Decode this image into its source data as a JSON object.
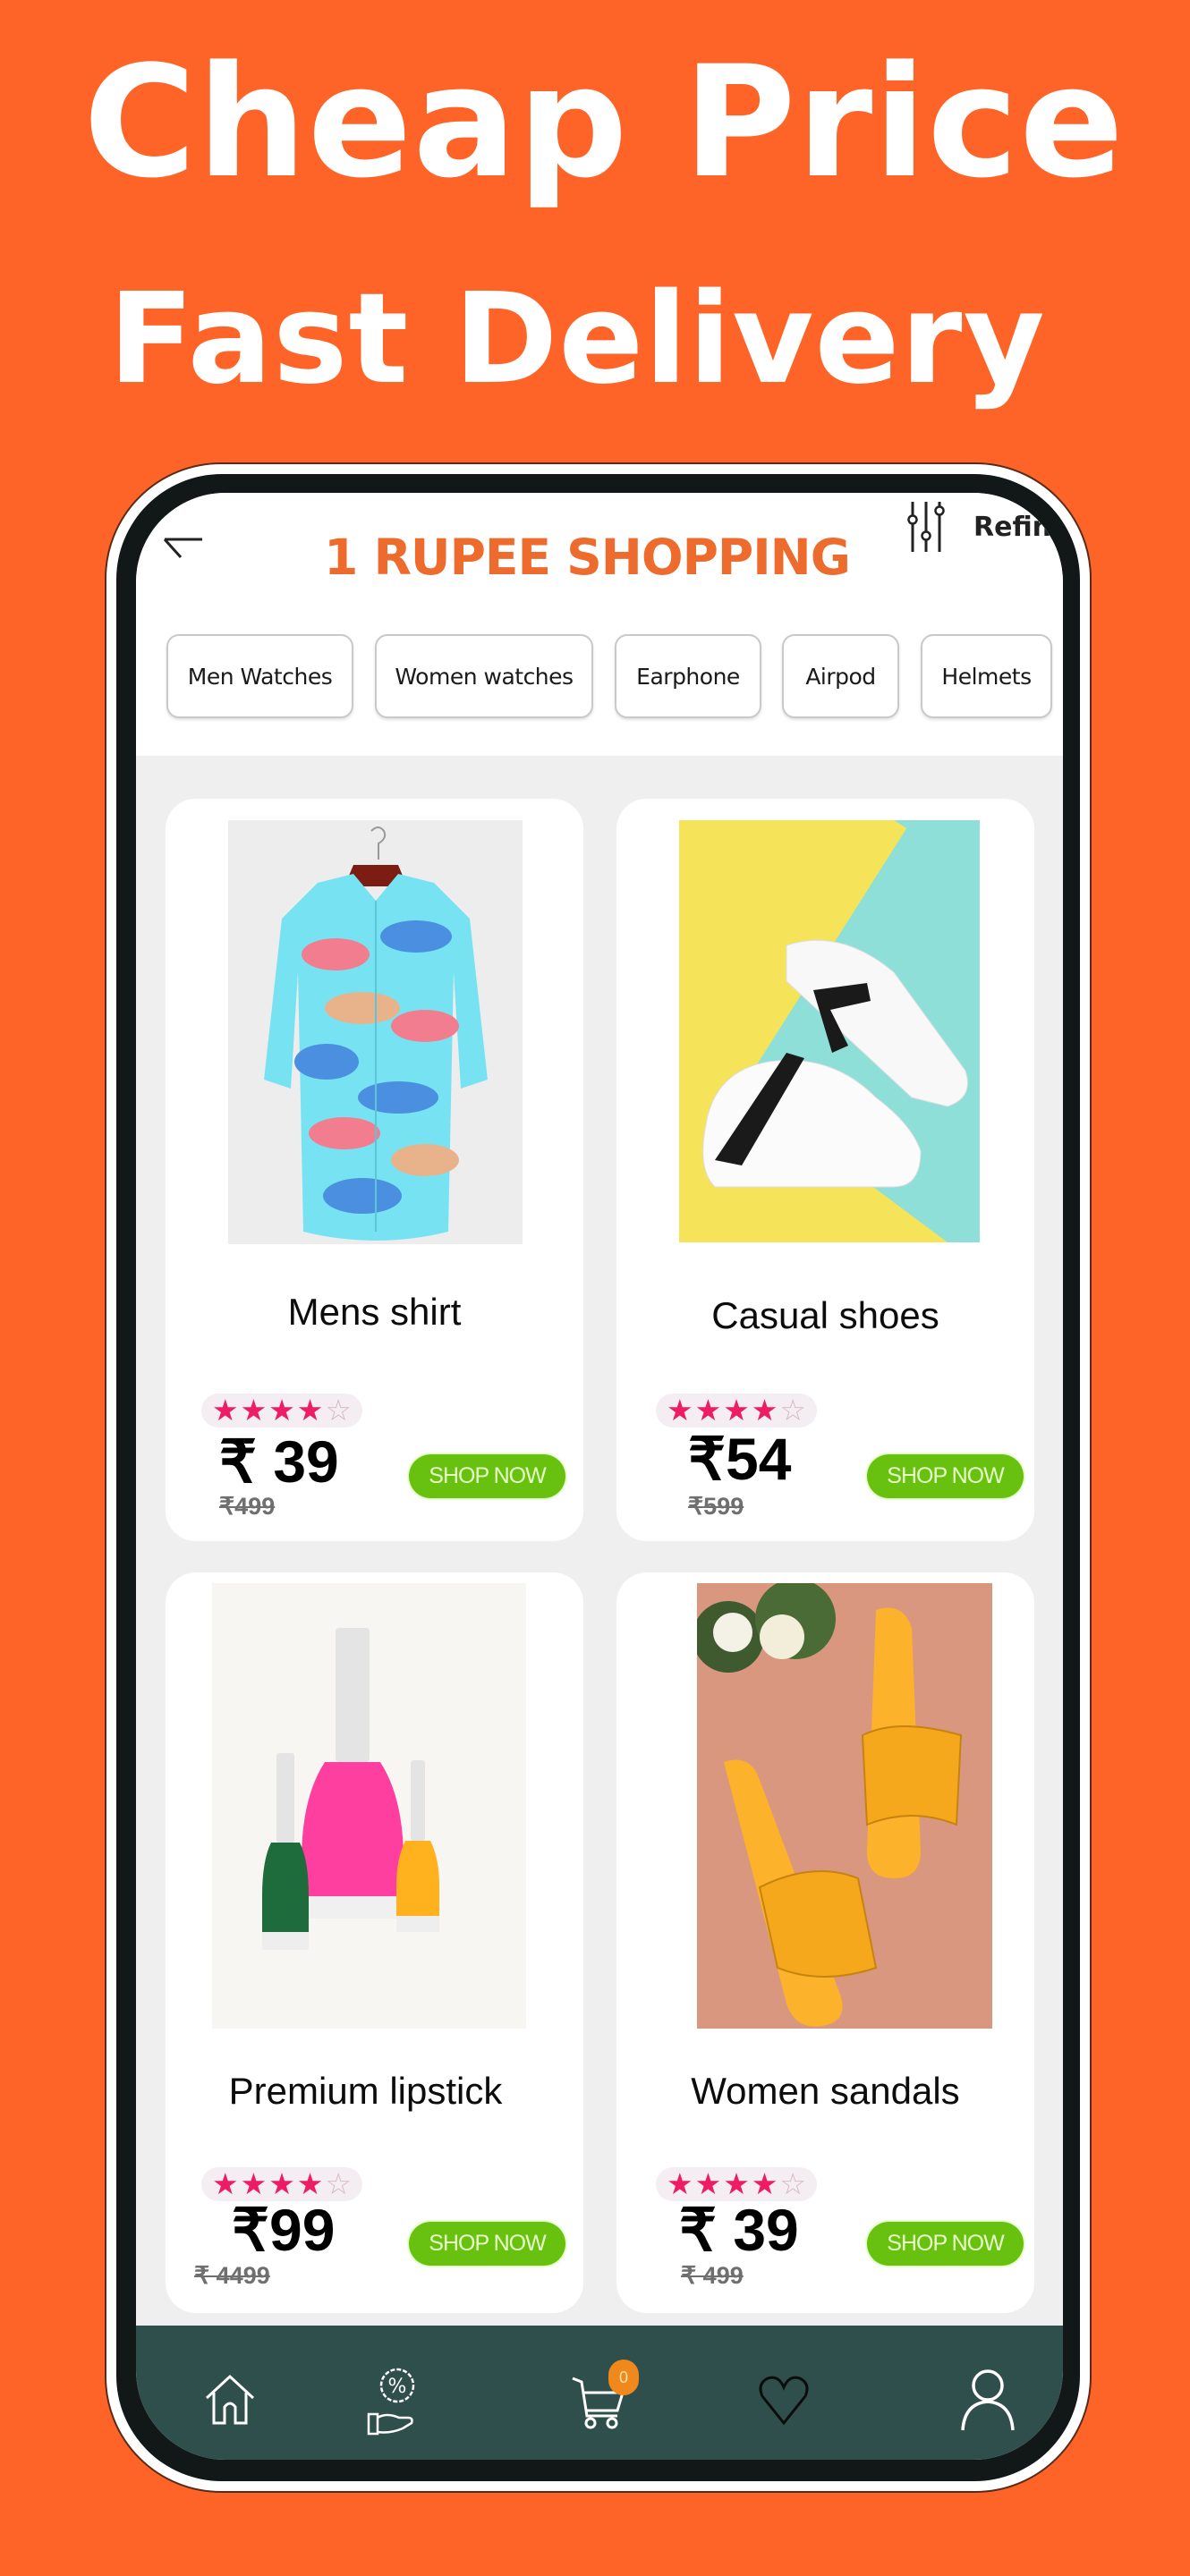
{
  "banner": {
    "line1": "Cheap Price",
    "line2": "Fast Delivery",
    "background_color": "#FE6427"
  },
  "app": {
    "title": "1 RUPEE SHOPPING",
    "title_color": "#EE6B2E",
    "back_icon": "back-arrow-icon",
    "refine": {
      "icon": "sliders-icon",
      "label": "Refine"
    }
  },
  "categories": [
    {
      "label": "Men Watches"
    },
    {
      "label": "Women watches"
    },
    {
      "label": "Earphone"
    },
    {
      "label": "Airpod"
    },
    {
      "label": "Helmets"
    }
  ],
  "products": [
    {
      "name": "Mens shirt",
      "rating": 4,
      "rating_max": 5,
      "price": "₹ 39",
      "old_price": "₹499",
      "button": "SHOP NOW",
      "image": "shirt-image"
    },
    {
      "name": "Casual shoes",
      "rating": 4,
      "rating_max": 5,
      "price": "₹54",
      "old_price": "₹599",
      "button": "SHOP NOW",
      "image": "shoes-image"
    },
    {
      "name": "Premium lipstick",
      "rating": 4,
      "rating_max": 5,
      "price": "₹99",
      "old_price": "₹ 4499",
      "button": "SHOP NOW",
      "image": "nail-polish-image"
    },
    {
      "name": "Women sandals",
      "rating": 4,
      "rating_max": 5,
      "price": "₹ 39",
      "old_price": "₹ 499",
      "button": "SHOP NOW",
      "image": "sandals-image"
    }
  ],
  "bottom_nav": {
    "items": [
      {
        "icon": "home-icon"
      },
      {
        "icon": "offers-icon"
      },
      {
        "icon": "cart-icon",
        "badge": "0"
      },
      {
        "icon": "heart-icon"
      },
      {
        "icon": "profile-icon"
      }
    ],
    "background_color": "#2F4F4D"
  },
  "colors": {
    "star": "#EE1D63",
    "shop_button": "#69C10F",
    "badge": "#F0881B"
  }
}
